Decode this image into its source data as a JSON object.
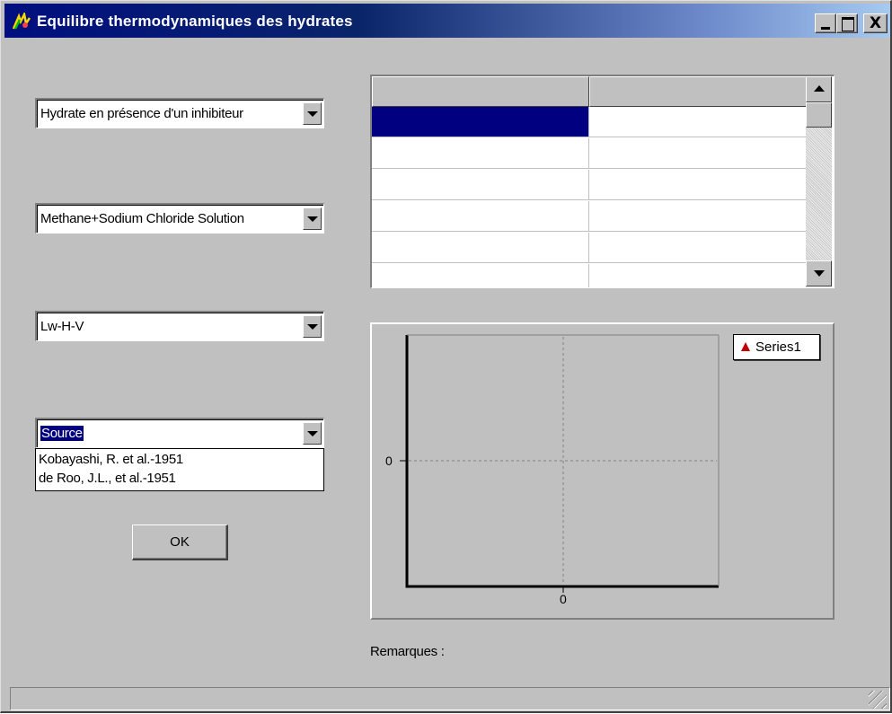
{
  "window": {
    "title": "Equilibre thermodynamiques des hydrates",
    "app_icon": "hydrate-app-icon",
    "controls": [
      "minimize",
      "maximize",
      "close"
    ],
    "close_glyph": "X"
  },
  "combos": {
    "hydrate_type": {
      "value": "Hydrate en présence d'un inhibiteur"
    },
    "system": {
      "value": "Methane+Sodium Chloride Solution"
    },
    "phase": {
      "value": "Lw-H-V"
    },
    "source": {
      "value": "Source",
      "options": [
        "Kobayashi, R. et al.-1951",
        "de Roo, J.L., et al.-1951"
      ]
    }
  },
  "ok_button": {
    "label": "OK"
  },
  "grid": {
    "columns": [
      "",
      ""
    ],
    "rows": [
      [
        "",
        ""
      ],
      [
        "",
        ""
      ],
      [
        "",
        ""
      ],
      [
        "",
        ""
      ],
      [
        "",
        ""
      ],
      [
        "",
        ""
      ]
    ],
    "selected_row": 0
  },
  "chart_data": {
    "type": "scatter",
    "title": "",
    "xlabel": "",
    "ylabel": "",
    "x_ticks": [
      "0"
    ],
    "y_ticks": [
      "0"
    ],
    "series": [
      {
        "name": "Series1",
        "marker": "triangle",
        "color": "#c00000",
        "points": []
      }
    ],
    "grid": true,
    "legend": "top-right"
  },
  "remarks": {
    "label": "Remarques :"
  },
  "colors": {
    "face": "#c0c0c0",
    "selection": "#000080",
    "title_start": "#000f7f",
    "title_end": "#a6caf0"
  }
}
